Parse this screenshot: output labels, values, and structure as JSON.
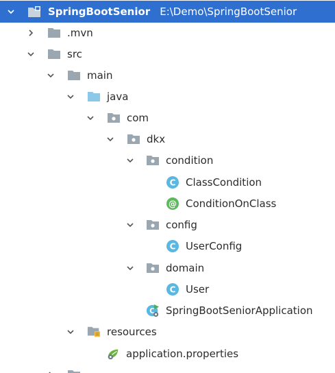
{
  "project": {
    "name": "SpringBootSenior",
    "path": "E:\\Demo\\SpringBootSenior"
  },
  "nodes": [
    {
      "label": ".mvn"
    },
    {
      "label": "src"
    },
    {
      "label": "main"
    },
    {
      "label": "java"
    },
    {
      "label": "com"
    },
    {
      "label": "dkx"
    },
    {
      "label": "condition"
    },
    {
      "label": "ClassCondition"
    },
    {
      "label": "ConditionOnClass"
    },
    {
      "label": "config"
    },
    {
      "label": "UserConfig"
    },
    {
      "label": "domain"
    },
    {
      "label": "User"
    },
    {
      "label": "SpringBootSeniorApplication"
    },
    {
      "label": "resources"
    },
    {
      "label": "application.properties"
    }
  ],
  "colors": {
    "selection": "#2e6fd0",
    "folder": "#9aa7b0",
    "source_folder": "#8cc8e8",
    "class_icon": "#5ab7e0",
    "annotation_icon": "#5fb85f",
    "spring_green": "#6db33f"
  }
}
